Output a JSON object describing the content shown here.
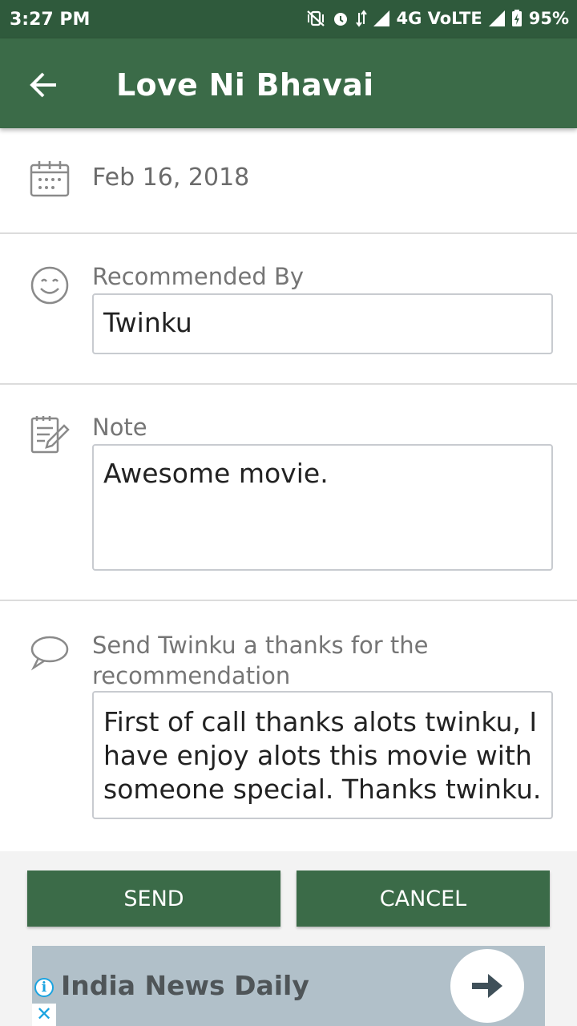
{
  "status_bar": {
    "time": "3:27 PM",
    "network": "4G VoLTE",
    "battery": "95%"
  },
  "app_bar": {
    "title": "Love Ni Bhavai"
  },
  "date_row": {
    "date": "Feb 16, 2018"
  },
  "recommended": {
    "label": "Recommended By",
    "value": "Twinku"
  },
  "note": {
    "label": "Note",
    "value": "Awesome movie."
  },
  "thanks": {
    "label_line1": "Send Twinku a thanks for the",
    "label_line2": "recommendation",
    "value": "First of call thanks alots twinku, I have enjoy alots this movie with someone special. Thanks twinku."
  },
  "buttons": {
    "send": "SEND",
    "cancel": "CANCEL"
  },
  "ad": {
    "title": "India News Daily",
    "info_glyph": "i",
    "close_glyph": "✕"
  },
  "colors": {
    "primary": "#3b6b48",
    "status": "#2f5a3c",
    "ad_bg": "#b1c0c9"
  }
}
